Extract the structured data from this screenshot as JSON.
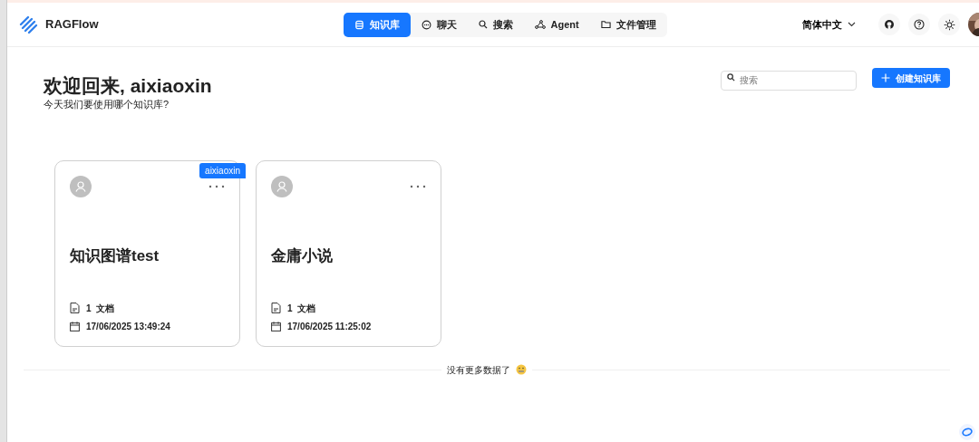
{
  "brand": {
    "name": "RAGFlow"
  },
  "nav": [
    {
      "label": "知识库",
      "kind": "database",
      "selected": true
    },
    {
      "label": "聊天",
      "kind": "chat",
      "selected": false
    },
    {
      "label": "搜索",
      "kind": "search",
      "selected": false
    },
    {
      "label": "Agent",
      "kind": "agent",
      "selected": false
    },
    {
      "label": "文件管理",
      "kind": "folder",
      "selected": false
    }
  ],
  "language": "简体中文",
  "header": {
    "title": "欢迎回来, aixiaoxin",
    "subtitle": "今天我们要使用哪个知识库?"
  },
  "search": {
    "placeholder": "搜索"
  },
  "create_button": "创建知识库",
  "cards": [
    {
      "name": "知识图谱test",
      "badge": "aixiaoxin",
      "docs_count": "1",
      "docs_label": "文档",
      "updated": "17/06/2025 13:49:24"
    },
    {
      "name": "金庸小说",
      "docs_count": "1",
      "docs_label": "文档",
      "updated": "17/06/2025 11:25:02"
    }
  ],
  "footer": "没有更多数据了"
}
